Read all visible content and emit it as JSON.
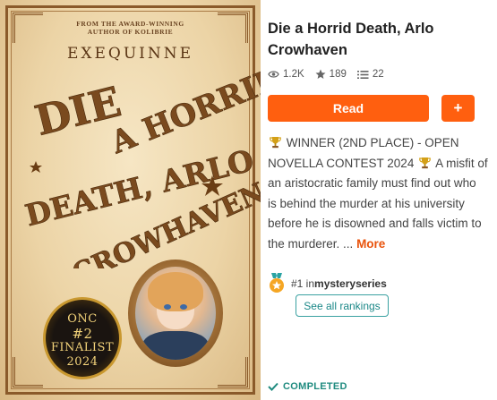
{
  "cover": {
    "tagline_line1": "From the Award-Winning",
    "tagline_line2": "Author of Kolibrie",
    "author": "EXEQUINNE",
    "title_lines": [
      "DIE",
      "A HORRID",
      "DEATH, ARLO",
      "CROWHAVEN"
    ],
    "badge": {
      "line1": "ONC",
      "line2": "#2",
      "line3": "FINALIST",
      "line4": "2024"
    },
    "colors": {
      "parchment": "#ecd4a6",
      "ink": "#7a4a1e",
      "gold": "#c9982f"
    }
  },
  "book": {
    "title": "Die a Horrid Death, Arlo Crowhaven",
    "stats": {
      "reads": "1.2K",
      "votes": "189",
      "parts": "22"
    },
    "read_label": "Read",
    "add_label": "+",
    "description": {
      "award_text": "WINNER (2ND PLACE) - OPEN NOVELLA CONTEST 2024",
      "summary": "A misfit of an aristocratic family must find out who is behind the murder at his university before he is disowned and falls victim to the murderer. ...",
      "more_label": "More"
    },
    "ranking": {
      "prefix": "#1 in ",
      "tag": "mysteryseries",
      "see_all_label": "See all rankings"
    },
    "status": "COMPLETED"
  },
  "icons": {
    "reads": "eye-icon",
    "votes": "star-icon",
    "parts": "list-icon",
    "award": "trophy-icon",
    "ranking": "medal-icon",
    "status": "checkmark-icon"
  },
  "accent": "#ff5f0f",
  "teal": "#1f8b7f"
}
